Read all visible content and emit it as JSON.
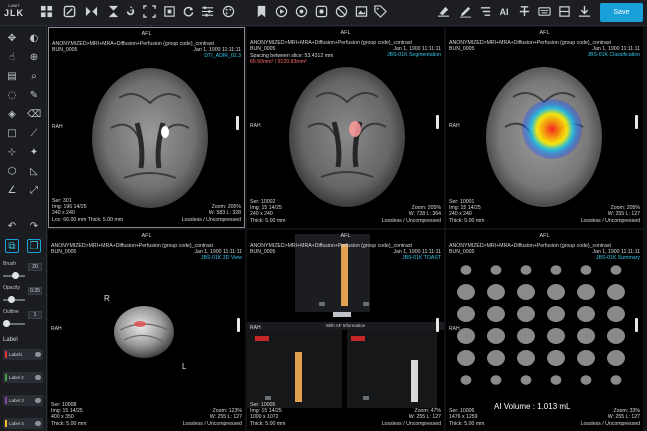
{
  "app": {
    "logo_top": "LUNIT",
    "logo_mid": "JLK",
    "save_label": "Save"
  },
  "toolbar": {
    "icons": [
      "grid-layout-icon",
      "edit-square-icon",
      "flip-horizontal-icon",
      "rotate-icon",
      "fit-screen-icon",
      "crop-icon",
      "refresh-icon",
      "sliders-icon",
      "palette-icon",
      "bookmark-icon",
      "play-circle-icon",
      "radio-circle-icon",
      "record-icon",
      "ban-icon",
      "image-icon",
      "tag-icon",
      "eraser-icon",
      "pen-icon",
      "list-icon",
      "ai-icon",
      "strikethrough-icon",
      "keyboard-icon",
      "layers-icon",
      "download-icon"
    ],
    "ai_text": "AI"
  },
  "sidebar": {
    "brush_label": "Brush",
    "brush_value": "20",
    "brush_level": 0.55,
    "opacity_label": "Opacity",
    "opacity_value": "0.35",
    "opacity_level": 0.35,
    "outline_label": "Outline",
    "outline_value": "1",
    "outline_level": 0.15,
    "label_header": "Label",
    "labels": [
      {
        "name": "Label1",
        "color": "#e53935"
      },
      {
        "name": "Label 2",
        "color": "#43a047"
      },
      {
        "name": "Label 3",
        "color": "#8e44ad"
      },
      {
        "name": "Label 4",
        "color": "#fbc02d"
      }
    ]
  },
  "viewports": [
    {
      "afl": "AFL",
      "patient": "ANONYMIZED>MRI+MRA+Diffusion+Perfusion (group code)_contrast",
      "study": "BUN_0005",
      "date": "Jan 1, 1900 11:11:11",
      "series_tag": "DTI_ADIR_02.3",
      "rah": "RAH",
      "ser": "Ser: 301",
      "img": "Img: 196 14/25",
      "dims": "240 x 240",
      "loc": "Loc: 66.00 mm Thick: 5.00 mm",
      "zoom": "Zoom: 205%",
      "wl": "W: 583 L: 328",
      "comp": "Lossless / Uncompressed"
    },
    {
      "afl": "AFL",
      "patient": "ANONYMIZED>MRI+MRA+Diffusion+Perfusion (group code)_contrast",
      "study": "BUN_0005",
      "date": "Jan 1, 1900 11:11:11",
      "spacing": "Spacing between slice: 53.4312 mm",
      "measure": "66.50mm² / 9120.93mm²",
      "series_tag": "JBS-01K Segmentation",
      "rah": "RAH",
      "ser": "Ser: 10002",
      "img": "Img: 15 14/25",
      "dims": "240 x 240",
      "loc": "Thick: 5.00 mm",
      "zoom": "Zoom: 205%",
      "wl": "W: 728 L: 364",
      "comp": "Lossless / Uncompressed"
    },
    {
      "afl": "AFL",
      "patient": "ANONYMIZED>MRI+MRA+Diffusion+Perfusion (group code)_contrast",
      "study": "BUN_0005",
      "date": "Jan 1, 1900 11:11:11",
      "series_tag": "JBS-01K Classification",
      "rah": "RAH",
      "ser": "Ser: 10001",
      "img": "Img: 15 14/25",
      "dims": "240 x 240",
      "loc": "Thick: 5.00 mm",
      "zoom": "Zoom: 205%",
      "wl": "W: 255 L: 127",
      "comp": "Lossless / Uncompressed"
    },
    {
      "afl": "AFL",
      "patient": "ANONYMIZED>MRI+MRA+Diffusion+Perfusion (group code)_contrast",
      "study": "BUN_0005",
      "date": "Jan 1, 1900 11:11:11",
      "series_tag": "JBS-01K 3D View",
      "rah": "RAH",
      "orient_r": "R",
      "orient_l": "L",
      "ser": "Ser: 10008",
      "img": "Img: 15 14/25",
      "dims": "400 x 350",
      "loc": "Thick: 5.00 mm",
      "zoom": "Zoom: 123%",
      "wl": "W: 255 L: 127",
      "comp": "Lossless / Uncompressed"
    },
    {
      "afl": "AFL",
      "patient": "ANONYMIZED>MRI+MRA+Diffusion+Perfusion (group code)_contrast",
      "study": "BUN_0005",
      "date": "Jan 1, 1900 11:11:11",
      "series_tag": "JBS-01K TOAST",
      "rah": "RAH",
      "panel_title": "With AF Information",
      "ser": "Ser: 10005",
      "img": "Img: 15 14/25",
      "dims": "1000 x 1072",
      "loc": "Thick: 5.00 mm",
      "zoom": "Zoom: 47%",
      "wl": "W: 255 L: 127",
      "comp": "Lossless / Uncompressed"
    },
    {
      "afl": "AFL",
      "patient": "ANONYMIZED>MRI+MRA+Diffusion+Perfusion (group code)_contrast",
      "study": "BUN_0005",
      "date": "Jan 1, 1900 11:11:11",
      "series_tag": "JBS-01K Summary",
      "rah": "RAH",
      "ai_volume": "AI Volume : 1.013 mL",
      "ser": "Ser: 10006",
      "img": "Img: 15 14/25",
      "dims": "1476 x 1259",
      "loc": "Thick: 5.00 mm",
      "zoom": "Zoom: 33%",
      "wl": "W: 255 L: 127",
      "comp": "Lossless / Uncompressed"
    }
  ]
}
